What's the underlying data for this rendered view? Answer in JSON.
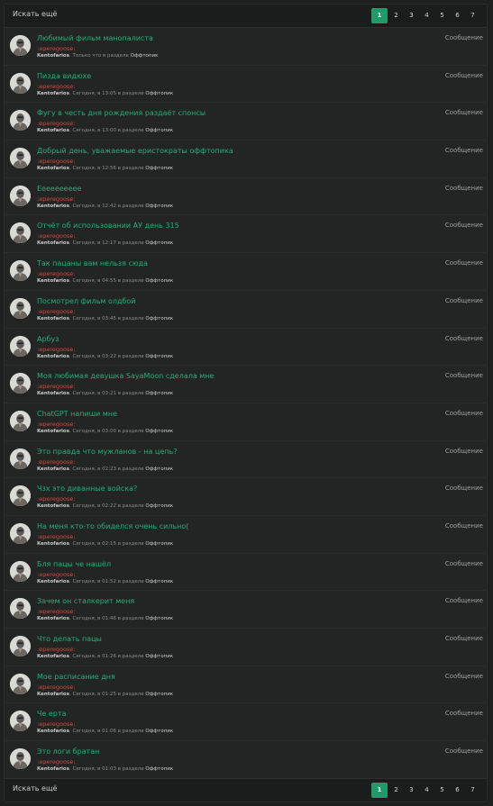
{
  "toolbar": {
    "search_more": "Искать ещё",
    "pages": [
      "1",
      "2",
      "3",
      "4",
      "5",
      "6",
      "7"
    ],
    "active_page": "1"
  },
  "results": [
    {
      "title": "Любимый фильм манопалиста",
      "tag": ":eperegoose:",
      "author": "Kentofarios",
      "time": "Только что",
      "section": "Оффтопик",
      "type": "Сообщение"
    },
    {
      "title": "Пизда видюхе",
      "tag": ":eperegoose:",
      "author": "Kentofarios",
      "time": "Сегодня, в 13:05",
      "section": "Оффтопик",
      "type": "Сообщение"
    },
    {
      "title": "Фугу в честь дня рождения раздаёт спонсы",
      "tag": ":eperegoose:",
      "author": "Kentofarios",
      "time": "Сегодня, в 13:00",
      "section": "Оффтопик",
      "type": "Сообщение"
    },
    {
      "title": "Добрый день, уважаемые еристократы оффтопика",
      "tag": ":eperegoose:",
      "author": "Kentofarios",
      "time": "Сегодня, в 12:56",
      "section": "Оффтопик",
      "type": "Сообщение"
    },
    {
      "title": "Ееееееееее",
      "tag": ":eperegoose:",
      "author": "Kentofarios",
      "time": "Сегодня, в 12:42",
      "section": "Оффтопик",
      "type": "Сообщение"
    },
    {
      "title": "Отчёт об использовании АУ день 315",
      "tag": ":eperegoose:",
      "author": "Kentofarios",
      "time": "Сегодня, в 12:17",
      "section": "Оффтопик",
      "type": "Сообщение"
    },
    {
      "title": "Так пацаны вам нельзя сюда",
      "tag": ":eperegoose:",
      "author": "Kentofarios",
      "time": "Сегодня, в 04:55",
      "section": "Оффтопик",
      "type": "Сообщение"
    },
    {
      "title": "Посмотрел фильм олдбой",
      "tag": ":eperegoose:",
      "author": "Kentofarios",
      "time": "Сегодня, в 03:45",
      "section": "Оффтопик",
      "type": "Сообщение"
    },
    {
      "title": "Арбуз",
      "tag": ":eperegoose:",
      "author": "Kentofarios",
      "time": "Сегодня, в 03:22",
      "section": "Оффтопик",
      "type": "Сообщение"
    },
    {
      "title": "Моя любимая девушка SayaMoon сделала мне",
      "tag": ":eperegoose:",
      "author": "Kentofarios",
      "time": "Сегодня, в 03:21",
      "section": "Оффтопик",
      "type": "Сообщение"
    },
    {
      "title": "ChatGPT напиши мне",
      "tag": ":eperegoose:",
      "author": "Kentofarios",
      "time": "Сегодня, в 03:00",
      "section": "Оффтопик",
      "type": "Сообщение"
    },
    {
      "title": "Это правда что мужланов - на цепь?",
      "tag": ":eperegoose:",
      "author": "Kentofarios",
      "time": "Сегодня, в 02:23",
      "section": "Оффтопик",
      "type": "Сообщение"
    },
    {
      "title": "Чзх это диванные войска?",
      "tag": ":eperegoose:",
      "author": "Kentofarios",
      "time": "Сегодня, в 02:22",
      "section": "Оффтопик",
      "type": "Сообщение"
    },
    {
      "title": "На меня кто-то обиделся очень сильно(",
      "tag": ":eperegoose:",
      "author": "Kentofarios",
      "time": "Сегодня, в 02:15",
      "section": "Оффтопик",
      "type": "Сообщение"
    },
    {
      "title": "Бля пацы че нашёл",
      "tag": ":eperegoose:",
      "author": "Kentofarios",
      "time": "Сегодня, в 01:52",
      "section": "Оффтопик",
      "type": "Сообщение"
    },
    {
      "title": "Зачем он сталкерит меня",
      "tag": ":eperegoose:",
      "author": "Kentofarios",
      "time": "Сегодня, в 01:46",
      "section": "Оффтопик",
      "type": "Сообщение"
    },
    {
      "title": "Что делать пацы",
      "tag": ":eperegoose:",
      "author": "Kentofarios",
      "time": "Сегодня, в 01:26",
      "section": "Оффтопик",
      "type": "Сообщение"
    },
    {
      "title": "Мое расписание дня",
      "tag": ":eperegoose:",
      "author": "Kentofarios",
      "time": "Сегодня, в 01:25",
      "section": "Оффтопик",
      "type": "Сообщение"
    },
    {
      "title": "Че ерта",
      "tag": ":eperegoose:",
      "author": "Kentofarios",
      "time": "Сегодня, в 01:06",
      "section": "Оффтопик",
      "type": "Сообщение"
    },
    {
      "title": "Это логи братан",
      "tag": ":eperegoose:",
      "author": "Kentofarios",
      "time": "Сегодня, в 01:03",
      "section": "Оффтопик",
      "type": "Сообщение"
    }
  ],
  "labels": {
    "in_section": "в разделе",
    "separator": "."
  },
  "colors": {
    "accent": "#1fb07a",
    "active_page": "#1f9a6b",
    "tag": "#d04a3f",
    "background": "#232424"
  }
}
